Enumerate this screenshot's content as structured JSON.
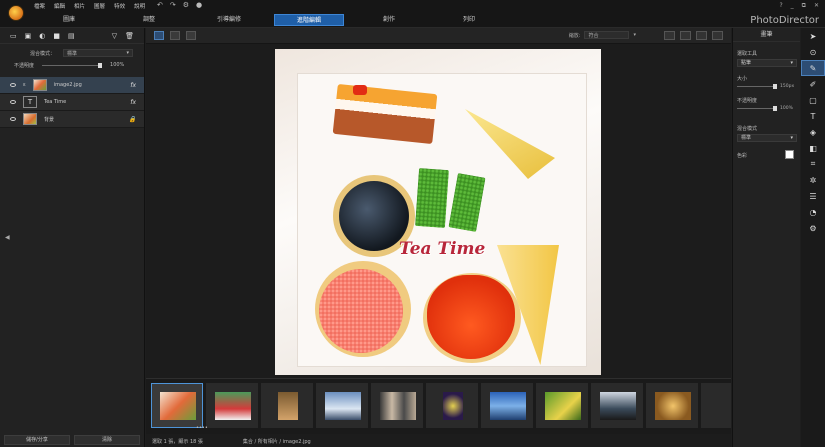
{
  "menu": [
    "檔案",
    "編輯",
    "相片",
    "圖層",
    "特效",
    "說明"
  ],
  "modes": [
    {
      "label": "圖庫",
      "active": false
    },
    {
      "label": "調整",
      "active": false
    },
    {
      "label": "引導編修",
      "active": false
    },
    {
      "label": "進階編輯",
      "active": true
    },
    {
      "label": "創作",
      "active": false
    },
    {
      "label": "列印",
      "active": false
    }
  ],
  "brand": "PhotoDirector",
  "window_controls": [
    "?",
    "_",
    "⧉",
    "✕"
  ],
  "left_panel": {
    "blend_label": "混合模式：",
    "blend_value": "標準",
    "opacity_label": "不透明度",
    "opacity_value": "100%",
    "layers": [
      {
        "name": "image2.jpg",
        "type": "image",
        "selected": true,
        "fx": "fx"
      },
      {
        "name": "Tea Time",
        "type": "text",
        "selected": false,
        "fx": "fx"
      },
      {
        "name": "背景",
        "type": "background",
        "selected": false,
        "fx": "🔒"
      }
    ],
    "buttons": {
      "save_share": "儲存/分享",
      "clear": "清除"
    }
  },
  "canvas": {
    "overlay_text": "Tea Time",
    "zoom_label": "縮放:",
    "zoom_value": "符合"
  },
  "filmstrip": {
    "count": 10,
    "selected_index": 0,
    "dots": "••••"
  },
  "status": {
    "selection": "選取 1 張，顯示 18 張",
    "path": "集合 / 所有相片 / image2.jpg"
  },
  "right_panel": {
    "title": "畫筆",
    "tool_label": "選取工具",
    "tool_value": "點筆",
    "size_label": "大小",
    "size_value": "150px",
    "opacity_label": "不透明度",
    "opacity_value": "100%",
    "blend_label": "混合模式",
    "blend_value": "標準",
    "color_label": "色彩"
  }
}
